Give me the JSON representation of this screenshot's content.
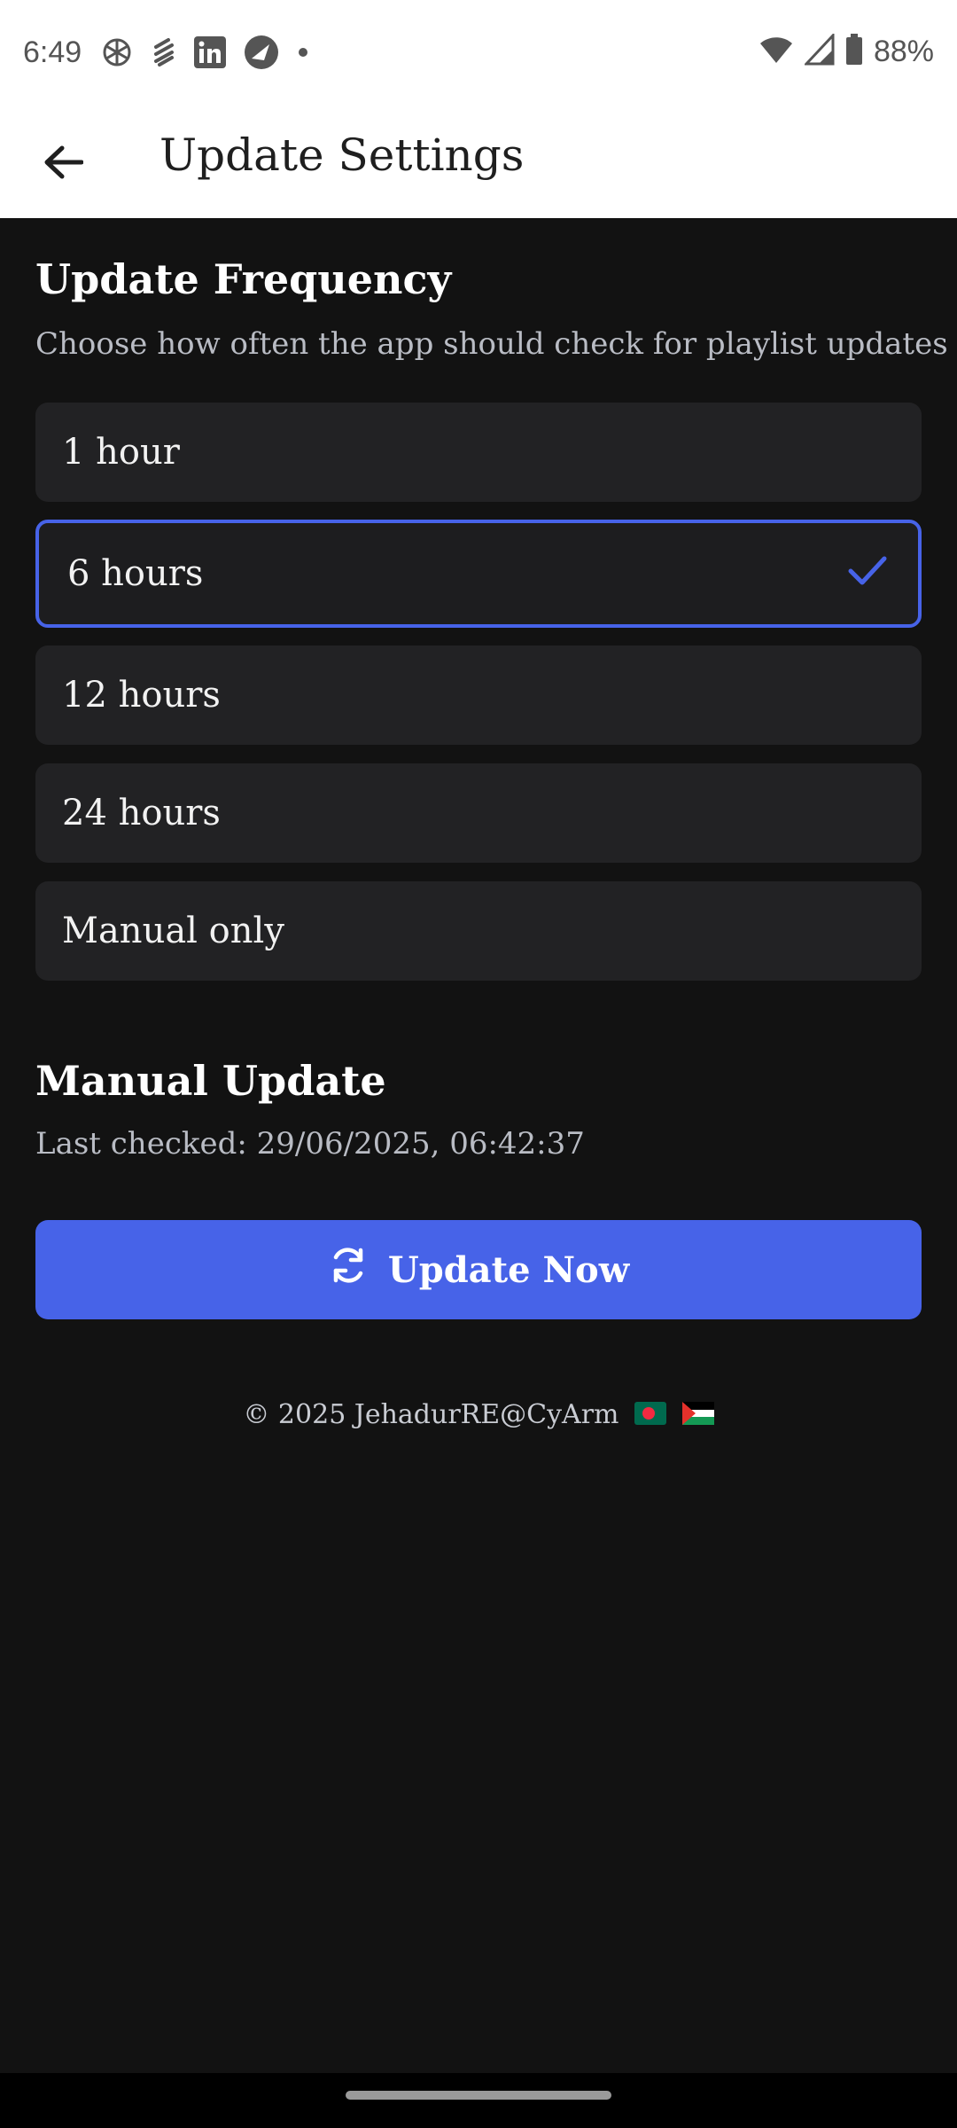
{
  "status_bar": {
    "time": "6:49",
    "notification_icons": [
      "openai-icon",
      "stack-icon",
      "linkedin-icon",
      "compass-icon",
      "dot-icon"
    ],
    "battery": "88%"
  },
  "app_bar": {
    "title": "Update Settings"
  },
  "frequency": {
    "title": "Update Frequency",
    "description": "Choose how often the app should check for playlist updates",
    "options": [
      {
        "label": "1 hour",
        "selected": false
      },
      {
        "label": "6 hours",
        "selected": true
      },
      {
        "label": "12 hours",
        "selected": false
      },
      {
        "label": "24 hours",
        "selected": false
      },
      {
        "label": "Manual only",
        "selected": false
      }
    ]
  },
  "manual": {
    "title": "Manual Update",
    "last_checked": "Last checked: 29/06/2025, 06:42:37",
    "button_label": "Update Now"
  },
  "footer": {
    "text": "© 2025 JehadurRE@CyArm"
  },
  "colors": {
    "accent": "#4763e8",
    "background": "#121212",
    "card": "#222224"
  }
}
